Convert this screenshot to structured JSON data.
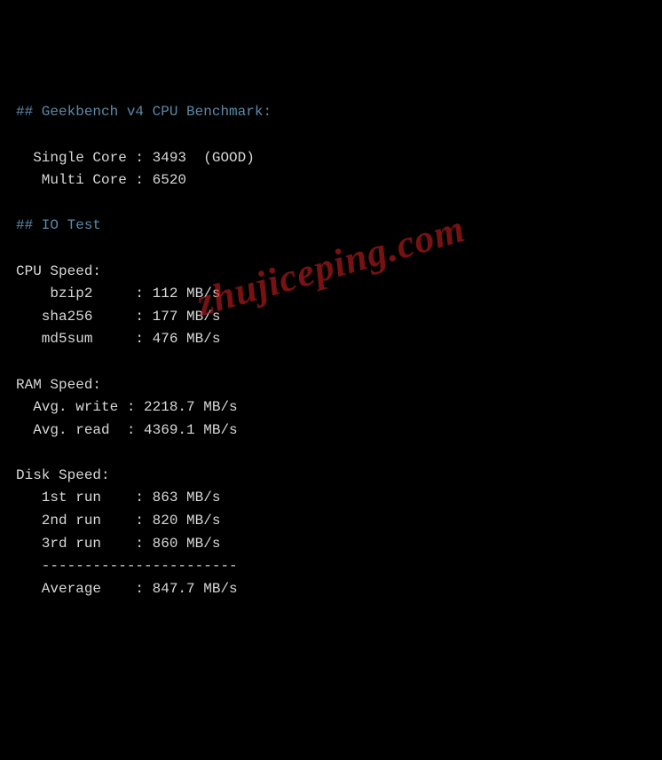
{
  "header_geekbench": "## Geekbench v4 CPU Benchmark:",
  "geekbench": {
    "single_line": "  Single Core : 3493  (GOOD)",
    "multi_line": "   Multi Core : 6520"
  },
  "header_iotest": "## IO Test",
  "cpu_speed_header": "CPU Speed:",
  "cpu_speed": {
    "bzip2": "    bzip2     : 112 MB/s",
    "sha256": "   sha256     : 177 MB/s",
    "md5sum": "   md5sum     : 476 MB/s"
  },
  "ram_speed_header": "RAM Speed:",
  "ram_speed": {
    "write": "  Avg. write : 2218.7 MB/s",
    "read": "  Avg. read  : 4369.1 MB/s"
  },
  "disk_speed_header": "Disk Speed:",
  "disk_speed": {
    "run1": "   1st run    : 863 MB/s",
    "run2": "   2nd run    : 820 MB/s",
    "run3": "   3rd run    : 860 MB/s",
    "divider": "   -----------------------",
    "average": "   Average    : 847.7 MB/s"
  },
  "watermark": "zhujiceping.com"
}
